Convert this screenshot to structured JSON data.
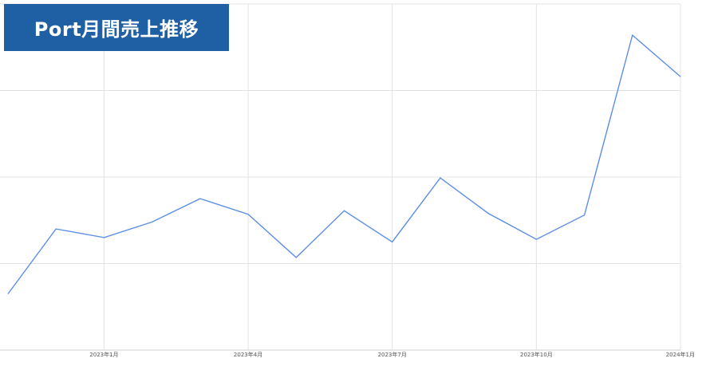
{
  "chart_data": {
    "type": "line",
    "title": "Port月間売上推移",
    "xlabel": "",
    "ylabel": "",
    "x": [
      "2022-11",
      "2022-12",
      "2023-01",
      "2023-02",
      "2023-03",
      "2023-04",
      "2023-05",
      "2023-06",
      "2023-07",
      "2023-08",
      "2023-09",
      "2023-10",
      "2023-11",
      "2023-12",
      "2024-01"
    ],
    "series": [
      {
        "values": [
          0.65,
          1.4,
          1.3,
          1.48,
          1.75,
          1.57,
          1.07,
          1.61,
          1.25,
          1.99,
          1.58,
          1.28,
          1.56,
          3.64,
          3.16
        ]
      }
    ],
    "ylim": [
      0,
      4
    ],
    "yticks": [
      0,
      1,
      2,
      3,
      4
    ],
    "xticks": [
      {
        "x": "2023-01",
        "label": "2023年1月"
      },
      {
        "x": "2023-04",
        "label": "2023年4月"
      },
      {
        "x": "2023-07",
        "label": "2023年7月"
      },
      {
        "x": "2023-10",
        "label": "2023年10月"
      },
      {
        "x": "2024-01",
        "label": "2024年1月"
      }
    ],
    "grid": true,
    "line_color": "#5b8ee6",
    "grid_color": "#e3e3e3",
    "title_bg_color": "#1f5fa3",
    "title_text_color": "#ffffff"
  }
}
